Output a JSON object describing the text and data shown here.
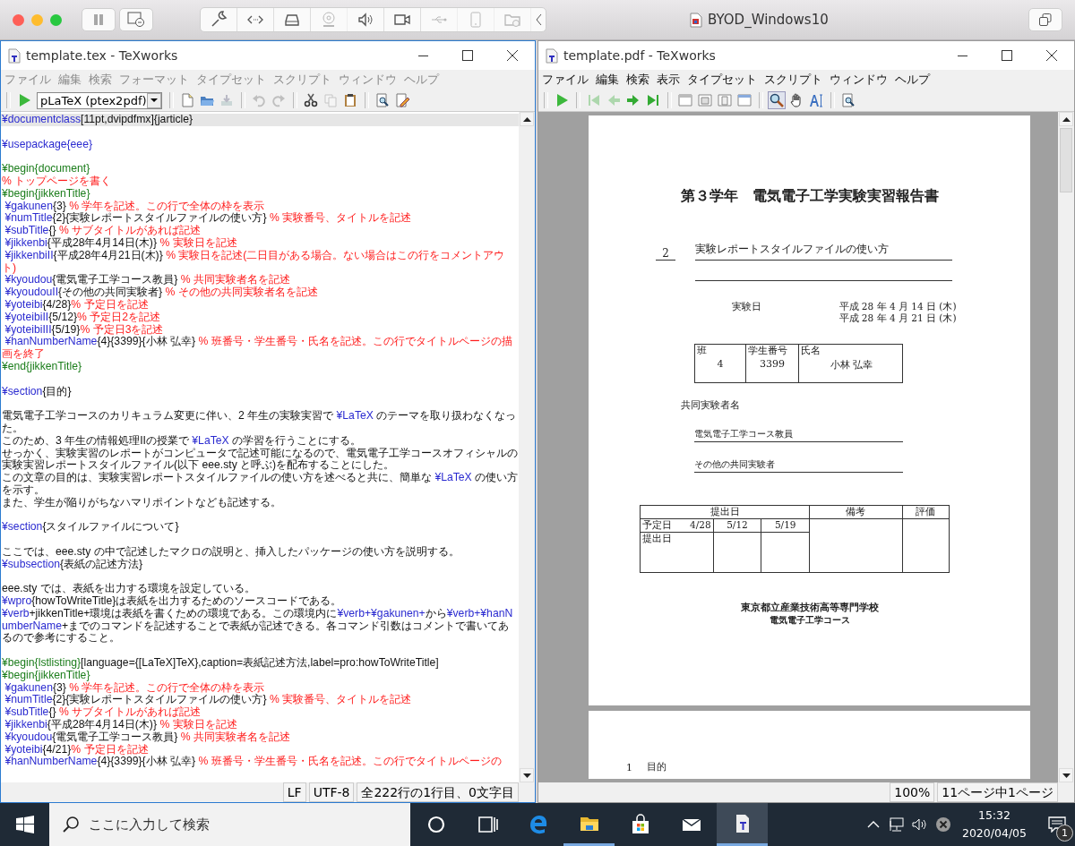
{
  "host": {
    "title": "BYOD_Windows10",
    "tools": [
      {
        "kind": "wrench",
        "disabled": false
      },
      {
        "kind": "code",
        "disabled": false
      },
      {
        "kind": "drive",
        "disabled": false
      },
      {
        "kind": "webcam",
        "disabled": true
      },
      {
        "kind": "speaker",
        "disabled": false
      },
      {
        "kind": "video",
        "disabled": false
      },
      {
        "kind": "usb",
        "disabled": true
      },
      {
        "kind": "phone",
        "disabled": true
      },
      {
        "kind": "shared-folder",
        "disabled": true
      }
    ]
  },
  "editor": {
    "title": "template.tex - TeXworks",
    "menu_dimmed": true,
    "menu": [
      "ファイル",
      "編集",
      "検索",
      "フォーマット",
      "タイプセット",
      "スクリプト",
      "ウィンドウ",
      "ヘルプ"
    ],
    "engine": "pLaTeX (ptex2pdf)",
    "toolbar": [
      [
        {
          "kind": "new",
          "disabled": false
        },
        {
          "kind": "open",
          "disabled": false
        },
        {
          "kind": "save",
          "disabled": true
        }
      ],
      [
        {
          "kind": "undo",
          "disabled": true
        },
        {
          "kind": "redo",
          "disabled": true
        }
      ],
      [
        {
          "kind": "cut",
          "disabled": false
        },
        {
          "kind": "copy",
          "disabled": true
        },
        {
          "kind": "paste",
          "disabled": false
        }
      ],
      [
        {
          "kind": "find",
          "disabled": false
        },
        {
          "kind": "replace",
          "disabled": false
        }
      ]
    ],
    "lines": [
      {
        "current": true,
        "segments": [
          {
            "kind": "cmd",
            "text": "¥documentclass"
          },
          {
            "kind": "text",
            "text": "[11pt,dvipdfmx]{jarticle}"
          }
        ]
      },
      {
        "current": false
      },
      {
        "current": false,
        "segments": [
          {
            "kind": "cmd",
            "text": "¥usepackage{eee}"
          }
        ]
      },
      {
        "current": false
      },
      {
        "current": false,
        "segments": [
          {
            "kind": "env",
            "text": "¥begin{document}"
          }
        ]
      },
      {
        "current": false,
        "segments": [
          {
            "kind": "comment",
            "text": "% トップページを書く"
          }
        ]
      },
      {
        "current": false,
        "segments": [
          {
            "kind": "env",
            "text": "¥begin{jikkenTitle}"
          }
        ]
      },
      {
        "current": false,
        "segments": [
          {
            "kind": "cmd",
            "text": " ¥gakunen"
          },
          {
            "kind": "text",
            "text": "{3} "
          },
          {
            "kind": "comment",
            "text": "% 学年を記述。この行で全体の枠を表示"
          }
        ]
      },
      {
        "current": false,
        "segments": [
          {
            "kind": "cmd",
            "text": " ¥numTitle"
          },
          {
            "kind": "text",
            "text": "{2}{実験レポートスタイルファイルの使い方} "
          },
          {
            "kind": "comment",
            "text": "% 実験番号、タイトルを記述"
          }
        ]
      },
      {
        "current": false,
        "segments": [
          {
            "kind": "cmd",
            "text": " ¥subTitle"
          },
          {
            "kind": "text",
            "text": "{} "
          },
          {
            "kind": "comment",
            "text": "% サブタイトルがあれば記述"
          }
        ]
      },
      {
        "current": false,
        "segments": [
          {
            "kind": "cmd",
            "text": " ¥jikkenbi"
          },
          {
            "kind": "text",
            "text": "{平成28年4月14日(木)} "
          },
          {
            "kind": "comment",
            "text": "% 実験日を記述"
          }
        ]
      },
      {
        "current": false,
        "segments": [
          {
            "kind": "cmd",
            "text": " ¥jikkenbiII"
          },
          {
            "kind": "text",
            "text": "{平成28年4月21日(木)} "
          },
          {
            "kind": "comment",
            "text": "% 実験日を記述(二日目がある場合。ない場合はこの行をコメントアウト)"
          }
        ]
      },
      {
        "current": false,
        "segments": [
          {
            "kind": "cmd",
            "text": " ¥kyoudou"
          },
          {
            "kind": "text",
            "text": "{電気電子工学コース教員} "
          },
          {
            "kind": "comment",
            "text": "% 共同実験者名を記述"
          }
        ]
      },
      {
        "current": false,
        "segments": [
          {
            "kind": "cmd",
            "text": " ¥kyoudouII"
          },
          {
            "kind": "text",
            "text": "{その他の共同実験者} "
          },
          {
            "kind": "comment",
            "text": "% その他の共同実験者名を記述"
          }
        ]
      },
      {
        "current": false,
        "segments": [
          {
            "kind": "cmd",
            "text": " ¥yoteibi"
          },
          {
            "kind": "text",
            "text": "{4/28}"
          },
          {
            "kind": "comment",
            "text": "% 予定日を記述"
          }
        ]
      },
      {
        "current": false,
        "segments": [
          {
            "kind": "cmd",
            "text": " ¥yoteibiII"
          },
          {
            "kind": "text",
            "text": "{5/12}"
          },
          {
            "kind": "comment",
            "text": "% 予定日2を記述"
          }
        ]
      },
      {
        "current": false,
        "segments": [
          {
            "kind": "cmd",
            "text": " ¥yoteibiIII"
          },
          {
            "kind": "text",
            "text": "{5/19}"
          },
          {
            "kind": "comment",
            "text": "% 予定日3を記述"
          }
        ]
      },
      {
        "current": false,
        "segments": [
          {
            "kind": "cmd",
            "text": " ¥hanNumberName"
          },
          {
            "kind": "text",
            "text": "{4}{3399}{小林 弘幸} "
          },
          {
            "kind": "comment",
            "text": "% 班番号・学生番号・氏名を記述。この行でタイトルページの描画を終了"
          }
        ]
      },
      {
        "current": false,
        "segments": [
          {
            "kind": "env",
            "text": "¥end{jikkenTitle}"
          }
        ]
      },
      {
        "current": false
      },
      {
        "current": false,
        "segments": [
          {
            "kind": "cmd",
            "text": "¥section"
          },
          {
            "kind": "text",
            "text": "{目的}"
          }
        ]
      },
      {
        "current": false
      },
      {
        "current": false,
        "segments": [
          {
            "kind": "text",
            "text": "電気電子工学コースのカリキュラム変更に伴い、2 年生の実験実習で "
          },
          {
            "kind": "cmd",
            "text": "¥LaTeX"
          },
          {
            "kind": "text",
            "text": " のテーマを取り扱わなくなった。"
          }
        ]
      },
      {
        "current": false,
        "segments": [
          {
            "kind": "text",
            "text": "このため、3 年生の情報処理IIの授業で "
          },
          {
            "kind": "cmd",
            "text": "¥LaTeX"
          },
          {
            "kind": "text",
            "text": " の学習を行うことにする。"
          }
        ]
      },
      {
        "current": false,
        "segments": [
          {
            "kind": "text",
            "text": "せっかく、実験実習のレポートがコンピュータで記述可能になるので、電気電子工学コースオフィシャルの実験実習レポートスタイルファイル(以下 eee.sty と呼ぶ)を配布することにした。"
          }
        ]
      },
      {
        "current": false,
        "segments": [
          {
            "kind": "text",
            "text": "この文章の目的は、実験実習レポートスタイルファイルの使い方を述べると共に、簡単な "
          },
          {
            "kind": "cmd",
            "text": "¥LaTeX"
          },
          {
            "kind": "text",
            "text": " の使い方を示す。"
          }
        ]
      },
      {
        "current": false,
        "segments": [
          {
            "kind": "text",
            "text": "また、学生が陥りがちなハマリポイントなども記述する。"
          }
        ]
      },
      {
        "current": false
      },
      {
        "current": false,
        "segments": [
          {
            "kind": "cmd",
            "text": "¥section"
          },
          {
            "kind": "text",
            "text": "{スタイルファイルについて}"
          }
        ]
      },
      {
        "current": false
      },
      {
        "current": false,
        "segments": [
          {
            "kind": "text",
            "text": "ここでは、eee.sty の中で記述したマクロの説明と、挿入したパッケージの使い方を説明する。"
          }
        ]
      },
      {
        "current": false,
        "segments": [
          {
            "kind": "cmd",
            "text": "¥subsection"
          },
          {
            "kind": "text",
            "text": "{表紙の記述方法}"
          }
        ]
      },
      {
        "current": false
      },
      {
        "current": false,
        "segments": [
          {
            "kind": "text",
            "text": "eee.sty では、表紙を出力する環境を設定している。"
          }
        ]
      },
      {
        "current": false,
        "segments": [
          {
            "kind": "cmd",
            "text": "¥wpro"
          },
          {
            "kind": "text",
            "text": "{howToWriteTitle}は表紙を出力するためのソースコードである。"
          }
        ]
      },
      {
        "current": false,
        "segments": [
          {
            "kind": "cmd",
            "text": "¥verb"
          },
          {
            "kind": "text",
            "text": "+jikkenTitle+環境は表紙を書くための環境である。この環境内に"
          },
          {
            "kind": "cmd",
            "text": "¥verb+¥gakunen+"
          },
          {
            "kind": "text",
            "text": "から"
          },
          {
            "kind": "cmd",
            "text": "¥verb+¥hanNumberName"
          },
          {
            "kind": "text",
            "text": "+までのコマンドを記述することで表紙が記述できる。各コマンド引数はコメントで書いてあるので参考にすること。"
          }
        ]
      },
      {
        "current": false
      },
      {
        "current": false,
        "segments": [
          {
            "kind": "env",
            "text": "¥begin{lstlisting}"
          },
          {
            "kind": "text",
            "text": "[language={[LaTeX]TeX},caption=表紙記述方法,label=pro:howToWriteTitle]"
          }
        ]
      },
      {
        "current": false,
        "segments": [
          {
            "kind": "env",
            "text": "¥begin{jikkenTitle}"
          }
        ]
      },
      {
        "current": false,
        "segments": [
          {
            "kind": "cmd",
            "text": " ¥gakunen"
          },
          {
            "kind": "text",
            "text": "{3} "
          },
          {
            "kind": "comment",
            "text": "% 学年を記述。この行で全体の枠を表示"
          }
        ]
      },
      {
        "current": false,
        "segments": [
          {
            "kind": "cmd",
            "text": " ¥numTitle"
          },
          {
            "kind": "text",
            "text": "{2}{実験レポートスタイルファイルの使い方} "
          },
          {
            "kind": "comment",
            "text": "% 実験番号、タイトルを記述"
          }
        ]
      },
      {
        "current": false,
        "segments": [
          {
            "kind": "cmd",
            "text": " ¥subTitle"
          },
          {
            "kind": "text",
            "text": "{} "
          },
          {
            "kind": "comment",
            "text": "% サブタイトルがあれば記述"
          }
        ]
      },
      {
        "current": false,
        "segments": [
          {
            "kind": "cmd",
            "text": " ¥jikkenbi"
          },
          {
            "kind": "text",
            "text": "{平成28年4月14日(木)} "
          },
          {
            "kind": "comment",
            "text": "% 実験日を記述"
          }
        ]
      },
      {
        "current": false,
        "segments": [
          {
            "kind": "cmd",
            "text": " ¥kyoudou"
          },
          {
            "kind": "text",
            "text": "{電気電子工学コース教員} "
          },
          {
            "kind": "comment",
            "text": "% 共同実験者名を記述"
          }
        ]
      },
      {
        "current": false,
        "segments": [
          {
            "kind": "cmd",
            "text": " ¥yoteibi"
          },
          {
            "kind": "text",
            "text": "{4/21}"
          },
          {
            "kind": "comment",
            "text": "% 予定日を記述"
          }
        ]
      },
      {
        "current": false,
        "segments": [
          {
            "kind": "cmd",
            "text": " ¥hanNumberName"
          },
          {
            "kind": "text",
            "text": "{4}{3399}{小林 弘幸} "
          },
          {
            "kind": "comment",
            "text": "% 班番号・学生番号・氏名を記述。この行でタイトルページの"
          }
        ]
      }
    ],
    "status": [
      "LF",
      "UTF-8",
      "全222行の1行目、0文字目"
    ]
  },
  "viewer": {
    "title": "template.pdf - TeXworks",
    "menu_dimmed": false,
    "menu": [
      "ファイル",
      "編集",
      "検索",
      "表示",
      "タイプセット",
      "スクリプト",
      "ウィンドウ",
      "ヘルプ"
    ],
    "toolbar": [
      [
        {
          "kind": "play",
          "disabled": false
        }
      ],
      [
        {
          "kind": "first",
          "disabled": true
        },
        {
          "kind": "prev",
          "disabled": true
        },
        {
          "kind": "next",
          "disabled": false
        },
        {
          "kind": "last",
          "disabled": false
        }
      ],
      [
        {
          "kind": "layout-single",
          "disabled": false
        },
        {
          "kind": "layout-width",
          "disabled": false
        },
        {
          "kind": "layout-page",
          "disabled": false
        },
        {
          "kind": "layout-fit",
          "disabled": false
        }
      ],
      [
        {
          "kind": "zoom",
          "disabled": false,
          "selected": true
        },
        {
          "kind": "hand",
          "disabled": false,
          "selected": false
        },
        {
          "kind": "text-select",
          "disabled": false,
          "selected": false
        }
      ],
      [
        {
          "kind": "find",
          "disabled": false
        }
      ]
    ],
    "document": {
      "title": "第３学年　電気電子工学実験実習報告書",
      "number": "2",
      "subject": "実験レポートスタイルファイルの使い方",
      "date_label": "実験日",
      "dates": [
        "平成 28 年 4 月 14 日 (木)",
        "平成 28 年 4 月 21 日 (木)"
      ],
      "student": [
        {
          "label": "班",
          "value": "4"
        },
        {
          "label": "学生番号",
          "value": "3399"
        },
        {
          "label": "氏名",
          "value": "小林 弘幸"
        }
      ],
      "partners_label": "共同実験者名",
      "partners": [
        "電気電子工学コース教員",
        "その他の共同実験者"
      ],
      "submission": {
        "headers": [
          "提出日",
          "備考",
          "評価"
        ],
        "planned_label": "予定日",
        "planned": [
          "4/28",
          "5/12",
          "5/19"
        ],
        "submitted_label": "提出日"
      },
      "school": "東京都立産業技術高等専門学校",
      "department": "電気電子工学コース"
    },
    "next_page": {
      "section_number": "1",
      "section_title": "目的"
    },
    "status": [
      "100%",
      "11ページ中1ページ"
    ]
  },
  "taskbar": {
    "search_placeholder": "ここに入力して検索",
    "apps": [
      {
        "kind": "cortana",
        "selected": false,
        "running": false
      },
      {
        "kind": "task-view",
        "selected": false,
        "running": false
      },
      {
        "kind": "edge",
        "selected": false,
        "running": false
      },
      {
        "kind": "explorer",
        "selected": false,
        "running": true
      },
      {
        "kind": "store",
        "selected": false,
        "running": false
      },
      {
        "kind": "mail",
        "selected": false,
        "running": false
      },
      {
        "kind": "texworks",
        "selected": true,
        "running": true
      }
    ],
    "time": "15:32",
    "date": "2020/04/05",
    "notifications": "1"
  }
}
